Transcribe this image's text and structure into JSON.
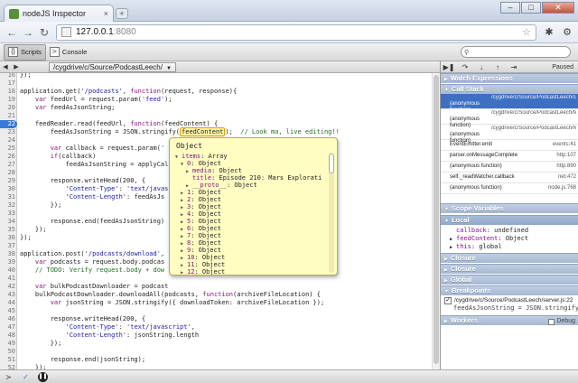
{
  "window": {
    "tab_title": "nodeJS Inspector",
    "tab_close": "×",
    "new_tab": "+",
    "min": "–",
    "max": "□",
    "close": "✕"
  },
  "nav": {
    "back": "←",
    "forward": "→",
    "reload": "↻",
    "url_host": "127.0.0.1",
    "url_port": ":8080",
    "star": "☆"
  },
  "devtools": {
    "tabs": [
      {
        "label": "Scripts",
        "icon": "scripts-icon"
      },
      {
        "label": "Console",
        "icon": "console-icon"
      }
    ],
    "search_placeholder": ""
  },
  "source": {
    "file": "/cygdrive/c/Source/PodcastLeech/",
    "lines": [
      {
        "n": "16",
        "html": "});"
      },
      {
        "n": "17",
        "html": ""
      },
      {
        "n": "18",
        "html": "application.get(<span class='str'>'/podcasts'</span>, <span class='kw'>function</span>(request, response){"
      },
      {
        "n": "19",
        "html": "    <span class='kw'>var</span> feedUrl = request.param(<span class='str'>'feed'</span>);"
      },
      {
        "n": "20",
        "html": "    <span class='kw'>var</span> feedAsJsonString;"
      },
      {
        "n": "21",
        "html": ""
      },
      {
        "n": "22",
        "html": "    feedReader.read(feedUrl, <span class='kw'>function</span>(feedContent) {",
        "bp": true
      },
      {
        "n": "23",
        "html": "        feedAsJsonString = JSON.stringify(<span class='hl'>feedContent</span>);  <span class='cmt'>// Look ma, live editing!!</span>"
      },
      {
        "n": "24",
        "html": ""
      },
      {
        "n": "25",
        "html": "        <span class='kw'>var</span> callback = request.param(<span class='str'>'</span>"
      },
      {
        "n": "26",
        "html": "        <span class='kw'>if</span>(callback)"
      },
      {
        "n": "27",
        "html": "            feedAsJsonString = applyCal"
      },
      {
        "n": "28",
        "html": ""
      },
      {
        "n": "29",
        "html": "        response.writeHead(200, {"
      },
      {
        "n": "30",
        "html": "            <span class='str'>'Content-Type'</span>: <span class='str'>'text/javas</span>"
      },
      {
        "n": "31",
        "html": "            <span class='str'>'Content-Length'</span>: feedAsJs"
      },
      {
        "n": "32",
        "html": "        });"
      },
      {
        "n": "33",
        "html": ""
      },
      {
        "n": "34",
        "html": "        response.end(feedAsJsonString)"
      },
      {
        "n": "35",
        "html": "    });"
      },
      {
        "n": "36",
        "html": "});"
      },
      {
        "n": "37",
        "html": ""
      },
      {
        "n": "38",
        "html": "application.post(<span class='str'>'/podcasts/download'</span>,"
      },
      {
        "n": "39",
        "html": "    <span class='kw'>var</span> podcasts = request.body.podcas"
      },
      {
        "n": "40",
        "html": "    <span class='cmt'>// TODO: Verify request.body + dow</span>"
      },
      {
        "n": "41",
        "html": ""
      },
      {
        "n": "42",
        "html": "    <span class='kw'>var</span> bulkPodcastDownloader = podcast"
      },
      {
        "n": "43",
        "html": "    bulkPodcastDownloader.downloadAll(podcasts, <span class='kw'>function</span>(archiveFileLocation) {"
      },
      {
        "n": "44",
        "html": "        <span class='kw'>var</span> jsonString = JSON.stringify({ downloadToken: archiveFileLocation });"
      },
      {
        "n": "45",
        "html": ""
      },
      {
        "n": "46",
        "html": "        response.writeHead(200, {"
      },
      {
        "n": "47",
        "html": "            <span class='str'>'Content-Type'</span>: <span class='str'>'text/javascript'</span>,"
      },
      {
        "n": "48",
        "html": "            <span class='str'>'Content-Length'</span>: jsonString.length"
      },
      {
        "n": "49",
        "html": "        });"
      },
      {
        "n": "50",
        "html": ""
      },
      {
        "n": "51",
        "html": "        response.end(jsonString);"
      },
      {
        "n": "52",
        "html": "    });"
      },
      {
        "n": "53",
        "html": "});"
      }
    ]
  },
  "popover": {
    "title": "Object",
    "rows": [
      {
        "indent": 0,
        "tri": "▼",
        "key": "items",
        "val": ": Array"
      },
      {
        "indent": 1,
        "tri": "▼",
        "key": "0",
        "val": ": Object"
      },
      {
        "indent": 2,
        "tri": "▶",
        "key": "media",
        "val": ": Object"
      },
      {
        "indent": 2,
        "tri": "",
        "key": "title",
        "val": ": Episode 210: Mars Explorati"
      },
      {
        "indent": 2,
        "tri": "▶",
        "key": "__proto__",
        "val": ": Object"
      },
      {
        "indent": 1,
        "tri": "▶",
        "key": "1",
        "val": ": Object"
      },
      {
        "indent": 1,
        "tri": "▶",
        "key": "2",
        "val": ": Object"
      },
      {
        "indent": 1,
        "tri": "▶",
        "key": "3",
        "val": ": Object"
      },
      {
        "indent": 1,
        "tri": "▶",
        "key": "4",
        "val": ": Object"
      },
      {
        "indent": 1,
        "tri": "▶",
        "key": "5",
        "val": ": Object"
      },
      {
        "indent": 1,
        "tri": "▶",
        "key": "6",
        "val": ": Object"
      },
      {
        "indent": 1,
        "tri": "▶",
        "key": "7",
        "val": ": Object"
      },
      {
        "indent": 1,
        "tri": "▶",
        "key": "8",
        "val": ": Object"
      },
      {
        "indent": 1,
        "tri": "▶",
        "key": "9",
        "val": ": Object"
      },
      {
        "indent": 1,
        "tri": "▶",
        "key": "10",
        "val": ": Object"
      },
      {
        "indent": 1,
        "tri": "▶",
        "key": "11",
        "val": ": Object"
      },
      {
        "indent": 1,
        "tri": "▶",
        "key": "12",
        "val": ": Object"
      }
    ]
  },
  "sidebar": {
    "paused": "Paused",
    "panes": {
      "watch": "Watch Expressions",
      "callstack": "Call Stack",
      "scope": "Scope Variables",
      "local": "Local",
      "closure1": "Closure",
      "closure2": "Closure",
      "global": "Global",
      "breakpoints": "Breakpoints",
      "workers": "Workers",
      "debug": "Debug"
    },
    "callstack": [
      {
        "fn": "(anonymous function)",
        "loc": "/cygdrive/c/Source/PodcastLeech/server.js:23",
        "sel": true
      },
      {
        "fn": "(anonymous function)",
        "loc": "/cygdrive/c/Source/PodcastLeech/feedReader.js"
      },
      {
        "fn": "(anonymous function)",
        "loc": "/cygdrive/c/Source/PodcastLeech/feedReader.js"
      },
      {
        "fn": "EventEmitter.emit",
        "loc": "events:41"
      },
      {
        "fn": "parser.onMessageComplete",
        "loc": "http:107"
      },
      {
        "fn": "(anonymous function)",
        "loc": "http:890"
      },
      {
        "fn": "self._readWatcher.callback",
        "loc": "net:472"
      },
      {
        "fn": "(anonymous function)",
        "loc": "node.js:768"
      }
    ],
    "scope": [
      {
        "key": "callback",
        "val": ": undefined",
        "tri": ""
      },
      {
        "key": "feedContent",
        "val": ": Object",
        "tri": "▶"
      },
      {
        "key": "this",
        "val": ": global",
        "tri": "▶"
      }
    ],
    "breakpoint_file": "/cygdrive/c/Source/PodcastLeech/server.js:22",
    "breakpoint_code": "feedAsJsonString = JSON.stringify..."
  },
  "status": {
    "console_icon": "≻",
    "debug_icon": "✓",
    "pause_icon": "❚❚"
  }
}
